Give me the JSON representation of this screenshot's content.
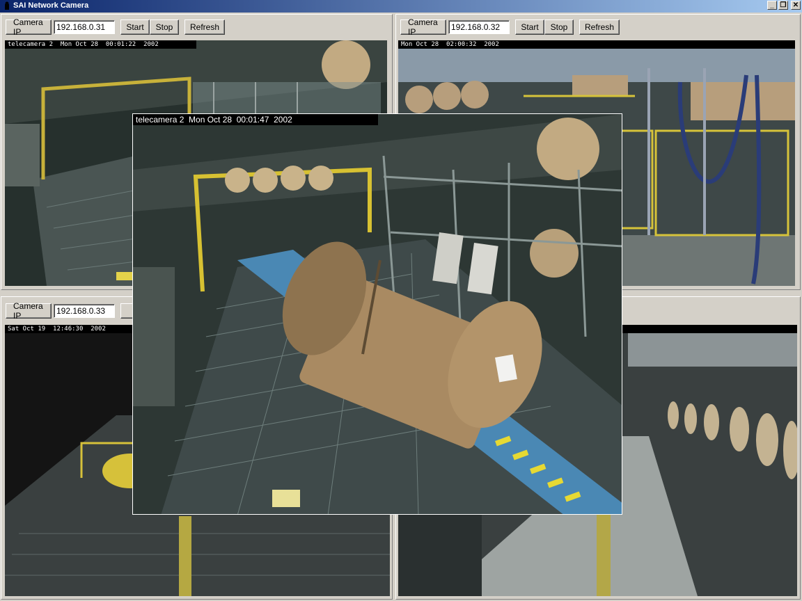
{
  "window": {
    "title": "SAI Network Camera",
    "buttons": {
      "minimize": "_",
      "restore": "❐",
      "close": "✕"
    }
  },
  "cameras": [
    {
      "ip_label": "Camera IP",
      "ip": "192.168.0.31",
      "start": "Start",
      "stop": "Stop",
      "refresh": "Refresh",
      "osd": "telecamera 2  Mon Oct 28  00:01:22  2002"
    },
    {
      "ip_label": "Camera IP",
      "ip": "192.168.0.32",
      "start": "Start",
      "stop": "Stop",
      "refresh": "Refresh",
      "osd": "Mon Oct 28  02:00:32  2002"
    },
    {
      "ip_label": "Camera IP",
      "ip": "192.168.0.33",
      "start": "S",
      "osd": "Sat Oct 19  12:46:30  2002"
    },
    {
      "osd": ""
    }
  ],
  "popup": {
    "osd": "telecamera 2  Mon Oct 28  00:01:47  2002"
  },
  "colors": {
    "title_bar_start": "#0a246a",
    "title_bar_end": "#a6caf0",
    "face": "#d4d0c8"
  },
  "icons": [
    "app-icon",
    "minimize-icon",
    "maximize-icon",
    "close-icon"
  ]
}
